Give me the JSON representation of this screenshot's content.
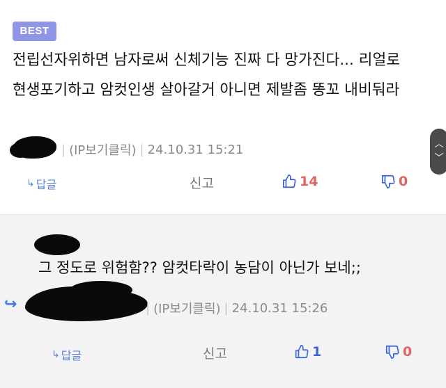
{
  "best_comment": {
    "badge": "BEST",
    "body": "전립선자위하면 남자로써 신체기능 진짜 다 망가진다... 리얼로 현생포기하고 암컷인생 살아갈거 아니면 제발좀 똥꼬 내비둬라",
    "ip_label": "(IP보기클릭)",
    "timestamp": "24.10.31 15:21",
    "reply_label": "답글",
    "report_label": "신고",
    "upvotes": "14",
    "downvotes": "0"
  },
  "reply_comment": {
    "body": "그 정도로 위험함?? 암컷타락이 농담이 아닌가 보네;;",
    "ip_label": "(IP보기클릭)",
    "timestamp": "24.10.31 15:26",
    "reply_label": "답글",
    "report_label": "신고",
    "upvotes": "1",
    "downvotes": "0"
  },
  "icons": {
    "reply_arrow": "reply-arrow-icon",
    "thumbs_up": "thumbs-up-icon",
    "thumbs_down": "thumbs-down-icon",
    "scroll_up": "chevron-up-icon",
    "scroll_down": "chevron-down-icon"
  },
  "colors": {
    "badge": "#8f96e6",
    "link_blue": "#5b82d6",
    "vote_red": "#e06464",
    "vote_blue": "#3b63d8",
    "reply_bg": "#f3f3f6"
  }
}
